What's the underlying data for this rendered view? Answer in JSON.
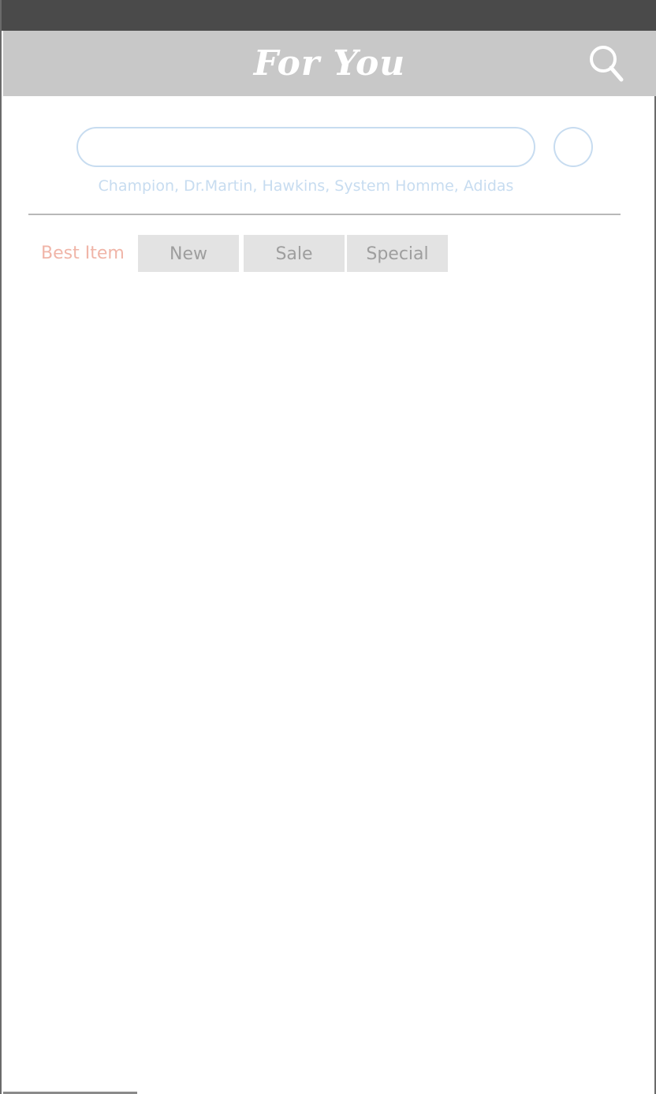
{
  "header": {
    "title": "For You",
    "search_icon": "search-icon"
  },
  "search": {
    "value": "",
    "placeholder": "",
    "suggestions": "Champion, Dr.Martin, Hawkins, System Homme, Adidas"
  },
  "tabs": {
    "best": "Best Item",
    "new": "New",
    "sale": "Sale",
    "special": "Special"
  },
  "colors": {
    "status_bar": "#4a4a4a",
    "header_bg": "#c8c8c8",
    "header_text": "#ffffff",
    "accent_blue": "#c7dcf0",
    "best_item": "#f0b5a8",
    "tab_bg": "#e3e3e3",
    "tab_text": "#9e9e9e"
  }
}
